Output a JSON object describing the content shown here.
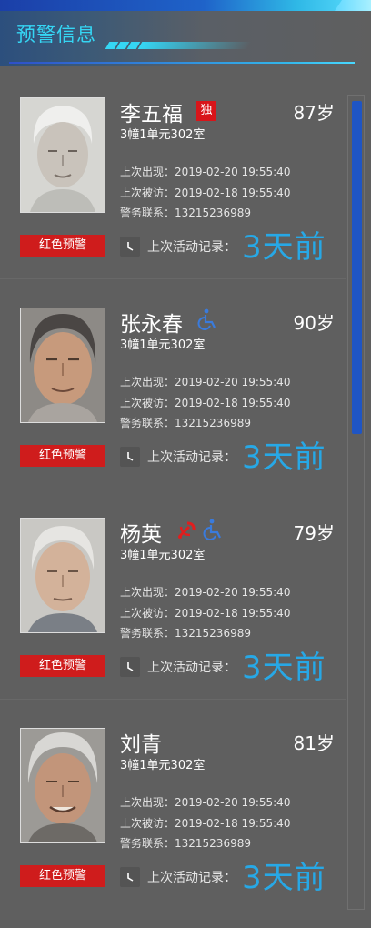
{
  "header": {
    "title": "预警信息"
  },
  "colors": {
    "accent_cyan": "#35d6f4",
    "warn_red": "#cf1c1c",
    "ago_blue": "#27a8e6",
    "wheelchair_blue": "#3a7bdc",
    "party_red": "#e01e1e"
  },
  "labels": {
    "warning": "红色预警",
    "activity": "上次活动记录：",
    "ago": "3天前"
  },
  "persons": [
    {
      "name": "李五福",
      "age": "87岁",
      "address": "3幢1单元302室",
      "last_seen": "上次出现：2019-02-20 19:55:40",
      "last_visit": "上次被访：2019-02-18 19:55:40",
      "police": "警务联系：13215236989",
      "badges": [
        "独"
      ]
    },
    {
      "name": "张永春",
      "age": "90岁",
      "address": "3幢1单元302室",
      "last_seen": "上次出现：2019-02-20 19:55:40",
      "last_visit": "上次被访：2019-02-18 19:55:40",
      "police": "警务联系：13215236989",
      "badges": [
        "wheelchair-icon"
      ]
    },
    {
      "name": "杨英",
      "age": "79岁",
      "address": "3幢1单元302室",
      "last_seen": "上次出现：2019-02-20 19:55:40",
      "last_visit": "上次被访：2019-02-18 19:55:40",
      "police": "警务联系：13215236989",
      "badges": [
        "party-emblem-icon",
        "wheelchair-icon"
      ]
    },
    {
      "name": "刘青",
      "age": "81岁",
      "address": "3幢1单元302室",
      "last_seen": "上次出现：2019-02-20 19:55:40",
      "last_visit": "上次被访：2019-02-18 19:55:40",
      "police": "警务联系：13215236989",
      "badges": []
    }
  ]
}
